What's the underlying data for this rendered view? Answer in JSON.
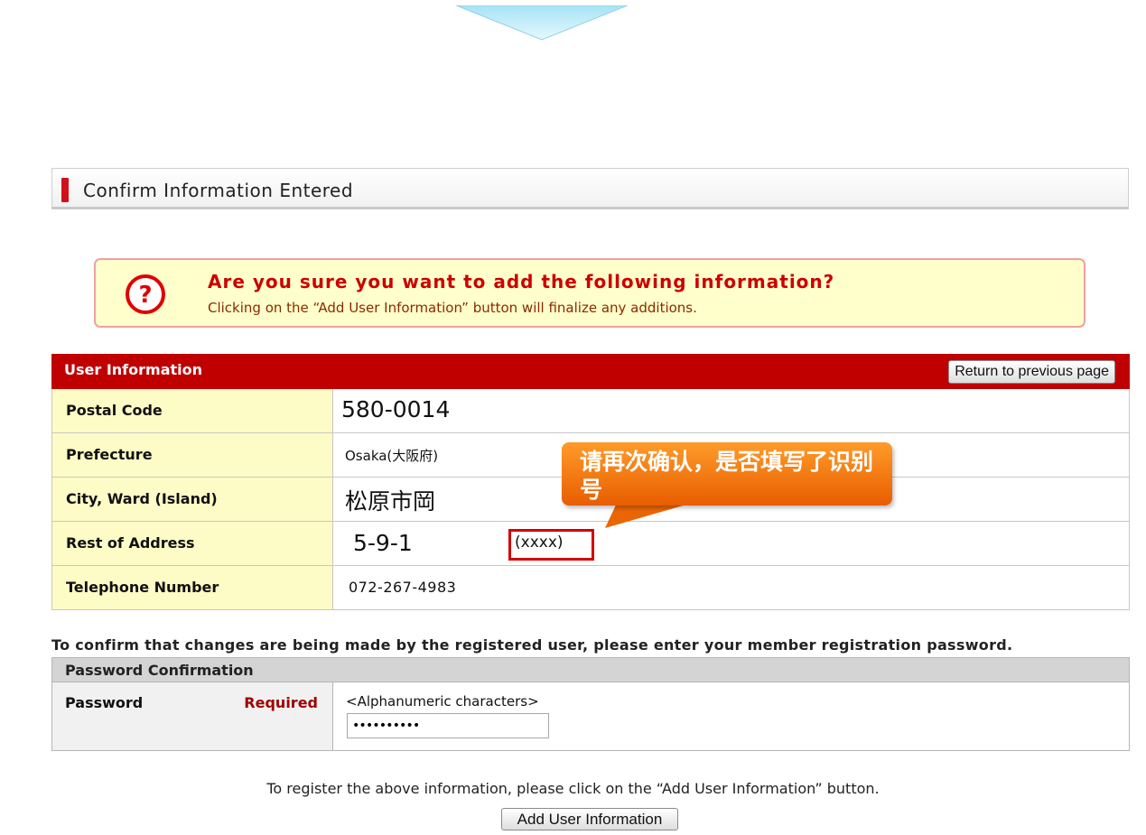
{
  "header": {
    "title": "Confirm Information Entered"
  },
  "alert": {
    "icon": "question-icon",
    "heading": "Are you sure you want to add the following information?",
    "subtext": "Clicking on the “Add User Information” button will finalize any additions."
  },
  "user_info": {
    "title": "User Information",
    "return_button": "Return to previous page",
    "rows": [
      {
        "label": "Postal Code",
        "value": "580-0014"
      },
      {
        "label": "Prefecture",
        "value": "Osaka(大阪府)"
      },
      {
        "label": "City, Ward (Island)",
        "value": "松原市岡"
      },
      {
        "label": "Rest of Address",
        "value": "5-9-1",
        "extra": "(xxxx)"
      },
      {
        "label": "Telephone Number",
        "value": "072-267-4983"
      }
    ]
  },
  "callout": {
    "text": "请再次确认，是否填写了识别号"
  },
  "password": {
    "instruction": "To confirm that changes are being made by the registered user, please enter your member registration password.",
    "section_title": "Password Confirmation",
    "label": "Password",
    "required": "Required",
    "hint": "<Alphanumeric characters>",
    "value": "••••••••••"
  },
  "footer": {
    "instruction": "To register the above information, please click on the “Add User Information” button.",
    "add_button": "Add User Information"
  },
  "colors": {
    "accent_red": "#c00000",
    "key_bg": "#fdfbc6",
    "callout": "#f07a10"
  }
}
